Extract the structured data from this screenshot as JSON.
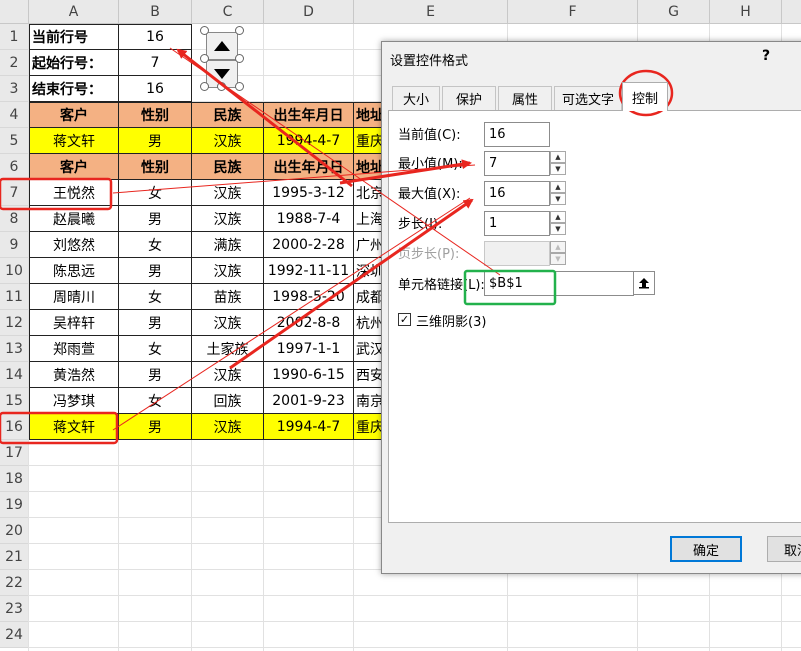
{
  "sheet": {
    "columns": [
      "A",
      "B",
      "C",
      "D",
      "E",
      "F",
      "G",
      "H"
    ],
    "rows": [
      "1",
      "2",
      "3",
      "4",
      "5",
      "6",
      "7",
      "8",
      "9",
      "10",
      "11",
      "12",
      "13",
      "14",
      "15",
      "16",
      "17",
      "18",
      "19",
      "20",
      "21",
      "22",
      "23",
      "24"
    ],
    "info": [
      {
        "label": "当前行号",
        "value": "16"
      },
      {
        "label": "起始行号：",
        "value": "7"
      },
      {
        "label": "结束行号：",
        "value": "16"
      }
    ],
    "headers": [
      "客户",
      "性别",
      "民族",
      "出生年月日",
      "地址"
    ],
    "lookup_row": [
      "蒋文轩",
      "男",
      "汉族",
      "1994-4-7",
      "重庆"
    ],
    "records": [
      [
        "王悦然",
        "女",
        "汉族",
        "1995-3-12",
        "北京"
      ],
      [
        "赵晨曦",
        "男",
        "汉族",
        "1988-7-4",
        "上海"
      ],
      [
        "刘悠然",
        "女",
        "满族",
        "2000-2-28",
        "广州"
      ],
      [
        "陈思远",
        "男",
        "汉族",
        "1992-11-11",
        "深圳"
      ],
      [
        "周晴川",
        "女",
        "苗族",
        "1998-5-20",
        "成都"
      ],
      [
        "吴梓轩",
        "男",
        "汉族",
        "2002-8-8",
        "杭州"
      ],
      [
        "郑雨萱",
        "女",
        "土家族",
        "1997-1-1",
        "武汉"
      ],
      [
        "黄浩然",
        "男",
        "汉族",
        "1990-6-15",
        "西安"
      ],
      [
        "冯梦琪",
        "女",
        "回族",
        "2001-9-23",
        "南京"
      ],
      [
        "蒋文轩",
        "男",
        "汉族",
        "1994-4-7",
        "重庆"
      ]
    ]
  },
  "colors": {
    "header_fill": "#f4b183",
    "highlight_fill": "#ffff00",
    "red_mark": "#e8261f",
    "green_mark": "#22b14c"
  },
  "dialog": {
    "title": "设置控件格式",
    "help": "?",
    "tabs": [
      "大小",
      "保护",
      "属性",
      "可选文字",
      "控制"
    ],
    "active_tab": "控制",
    "fields": {
      "current_label": "当前值(C):",
      "current_value": "16",
      "min_label": "最小值(M):",
      "min_value": "7",
      "max_label": "最大值(X):",
      "max_value": "16",
      "step_label": "步长(I):",
      "step_value": "1",
      "page_label": "页步长(P):",
      "page_value": "",
      "link_label": "单元格链接(L):",
      "link_value": "$B$1"
    },
    "shading_label": "三维阴影(3)",
    "shading_checked": true,
    "ok_label": "确定",
    "cancel_label": "取消"
  }
}
